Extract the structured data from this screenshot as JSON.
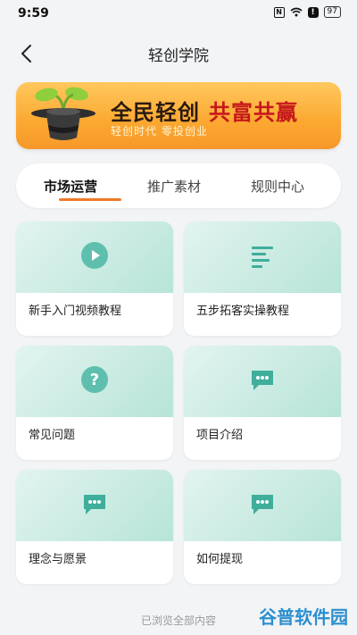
{
  "status_bar": {
    "time": "9:59",
    "nfc": "N",
    "alert": "!",
    "battery": "97"
  },
  "header": {
    "title": "轻创学院"
  },
  "banner": {
    "title_part1": "全民轻创",
    "title_part2": "共富共赢",
    "subtitle": "轻创时代 零投创业"
  },
  "tabs": [
    {
      "label": "市场运营",
      "active": true
    },
    {
      "label": "推广素材",
      "active": false
    },
    {
      "label": "规则中心",
      "active": false
    }
  ],
  "cards": [
    {
      "label": "新手入门视频教程",
      "icon": "play-icon"
    },
    {
      "label": "五步拓客实操教程",
      "icon": "document-lines-icon"
    },
    {
      "label": "常见问题",
      "icon": "question-icon"
    },
    {
      "label": "项目介绍",
      "icon": "chat-icon"
    },
    {
      "label": "理念与愿景",
      "icon": "chat-icon"
    },
    {
      "label": "如何提现",
      "icon": "chat-icon"
    }
  ],
  "footer": {
    "note": "已浏览全部内容"
  },
  "watermark": {
    "part1": "谷普",
    "part2": "软件园"
  },
  "colors": {
    "accent": "#ee7a2a",
    "icon_teal": "#3fae9b",
    "banner_red": "#c6191c"
  }
}
